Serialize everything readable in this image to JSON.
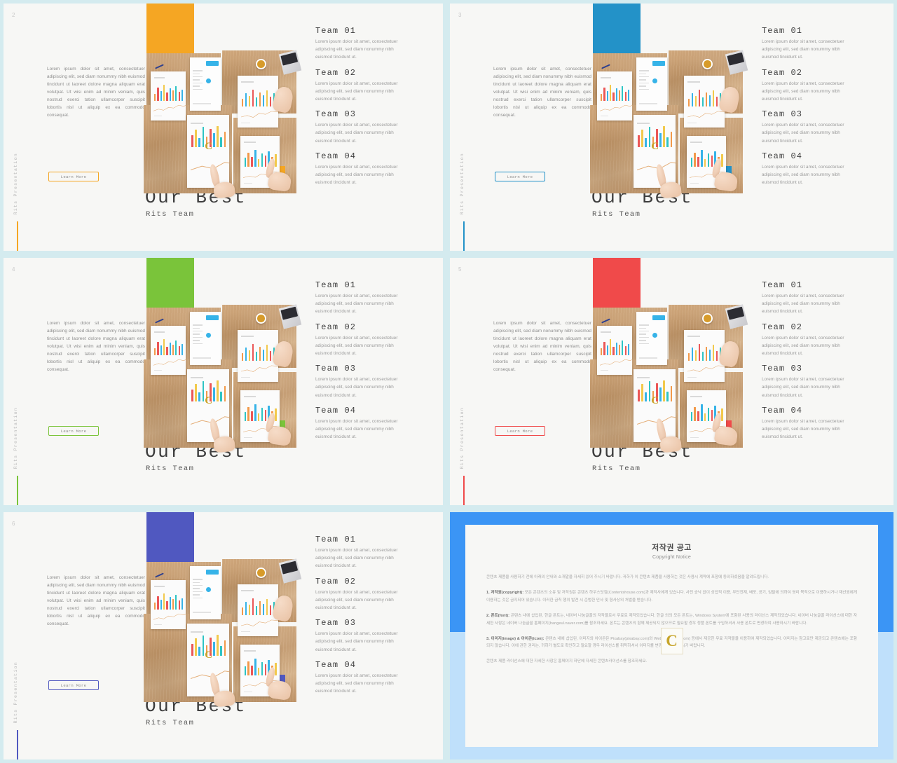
{
  "deck": {
    "side_label": "Rits Presentation",
    "learn_more_label": "Learn More",
    "title_main": "Our Best",
    "title_sub": "Rits Team",
    "body_paragraph": "Lorem ipsum dolor sit amet, consectetuer adipiscing elit, sed diam nonummy nibh euismod tincidunt ut laoreet dolore magna aliquam erat volutpat. Ut wisi enim ad minim veniam, quis nostrud exerci tation ullamcorper suscipit lobortis nisl ut aliquip ex ea commodo consequat.",
    "team_items": [
      {
        "heading": "Team 01",
        "body": "Lorem ipsum dolor sit amet, consectetuer adipiscing elit, sed diam nonummy nibh euismod tincidunt ut."
      },
      {
        "heading": "Team 02",
        "body": "Lorem ipsum dolor sit amet, consectetuer adipiscing elit, sed diam nonummy nibh euismod tincidunt ut."
      },
      {
        "heading": "Team 03",
        "body": "Lorem ipsum dolor sit amet, consectetuer adipiscing elit, sed diam nonummy nibh euismod tincidunt ut."
      },
      {
        "heading": "Team 04",
        "body": "Lorem ipsum dolor sit amet, consectetuer adipiscing elit, sed diam nonummy nibh euismod tincidunt ut."
      }
    ],
    "slides": [
      {
        "number": "2",
        "accent": "#F5A623",
        "accent_name": "orange"
      },
      {
        "number": "3",
        "accent": "#2392C8",
        "accent_name": "blue"
      },
      {
        "number": "4",
        "accent": "#7AC43A",
        "accent_name": "green"
      },
      {
        "number": "5",
        "accent": "#F04A4A",
        "accent_name": "red"
      },
      {
        "number": "6",
        "accent": "#5058C0",
        "accent_name": "indigo"
      }
    ]
  },
  "copyright_slide": {
    "frame_color": "#3B95F5",
    "lower_color": "#BFE0FB",
    "title_kr": "저작권 공고",
    "title_en": "Copyright Notice",
    "watermark_letter": "C",
    "paragraphs": [
      "콘텐츠 제품을 사용하기 전에 아래의 안내와 소개말을 자세히 읽어 주시기 바랍니다. 귀하가 이 콘텐츠 제품을 사용하는 것은 사용시 계약에 포함에 동의하셨음을 알려드립니다.",
      "<b>1. 저작권(copyright):</b> 모든 콘텐츠의 소유 및 저작권은 콘텐츠 하우스닷컴(Contentshouse.com)과 제작사에게 있습니다. 사전 승낙 없이 상업적 이용, 무단전재, 배포, 공기, 임탈에 의하여 영리 목적으로 이용하시거나 재산권에게 이용하는 것은 금지되어 있습니다. 이러한 금칙 행위 발견 시 준법한 민사 및 형사상의 처벌을 받습니다.",
      "<b>2. 폰트(font):</b> 콘텐츠 내에 삽입된, 한글 폰트는, 네이버 나눔글꼴의 저작물로서 무료로 제작되었습니다. 한글 외의 모든 폰트는, Windows System에 포함된 사용의 라이선스 제작되었습니다. 네이버 나눔글꼴 라이선스에 대한 자세한 사항은 네이버 나눔글꼴 홈페이지(hangeul.naver.com)를 참조하세요. 폰트는 콘텐츠의 함께 제공되지 않으므로 필요할 경우 정품 폰트를 구입하셔서 사용 폰트로 변경하여 사용하시기 바랍니다.",
      "<b>3. 이미지(image) &amp; 아이콘(icon):</b> 콘텐츠 내에 삽입된, 이미지와 아이콘은 Pixabay(pixabay.com)와 Webaly(webaly.com) 등에서 제공한 무료 저작물을 이용하여 제작되었습니다. 이미지는 참고로만 제공되고 콘텐츠에는 포함되지 않습니다. 이에 관한 권리는, 귀하가 별도로 확인하고 필요할 경우 라이선스를 취득하셔서 이미지를 변경하여 사용하시기 바랍니다.",
      "콘텐츠 제품 라이선스에 대한 자세한 사항은 홈페이지 하단에 자세한 콘텐츠라이선스를 참조하세요."
    ]
  }
}
